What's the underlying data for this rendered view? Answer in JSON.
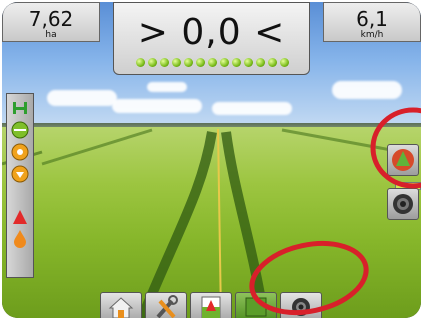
{
  "top": {
    "area": {
      "value": "7,62",
      "unit": "ha"
    },
    "speed": {
      "value": "6,1",
      "unit": "km/h"
    },
    "cross_track": "> 0,0 <",
    "lightbar_leds": 13
  },
  "left_bar": {
    "icons": [
      "boom-status-icon",
      "boom-width-icon",
      "guidance-mode-icon",
      "gps-status-icon",
      "tilt-icon",
      "product-icon"
    ]
  },
  "right_bar": {
    "buttons": [
      "vehicle-view-icon",
      "zoom-icon"
    ]
  },
  "bottom_bar": {
    "tabs": [
      "home-tab",
      "tools-tab",
      "guidance-tab",
      "map-tab",
      "camera-tab"
    ],
    "active": "map-tab"
  },
  "annotations": {
    "color": "#d8202a"
  },
  "colors": {
    "led_green": "#7bbd1b",
    "field_green": "#9cc540",
    "bar_gray": "#c9c9c9"
  }
}
